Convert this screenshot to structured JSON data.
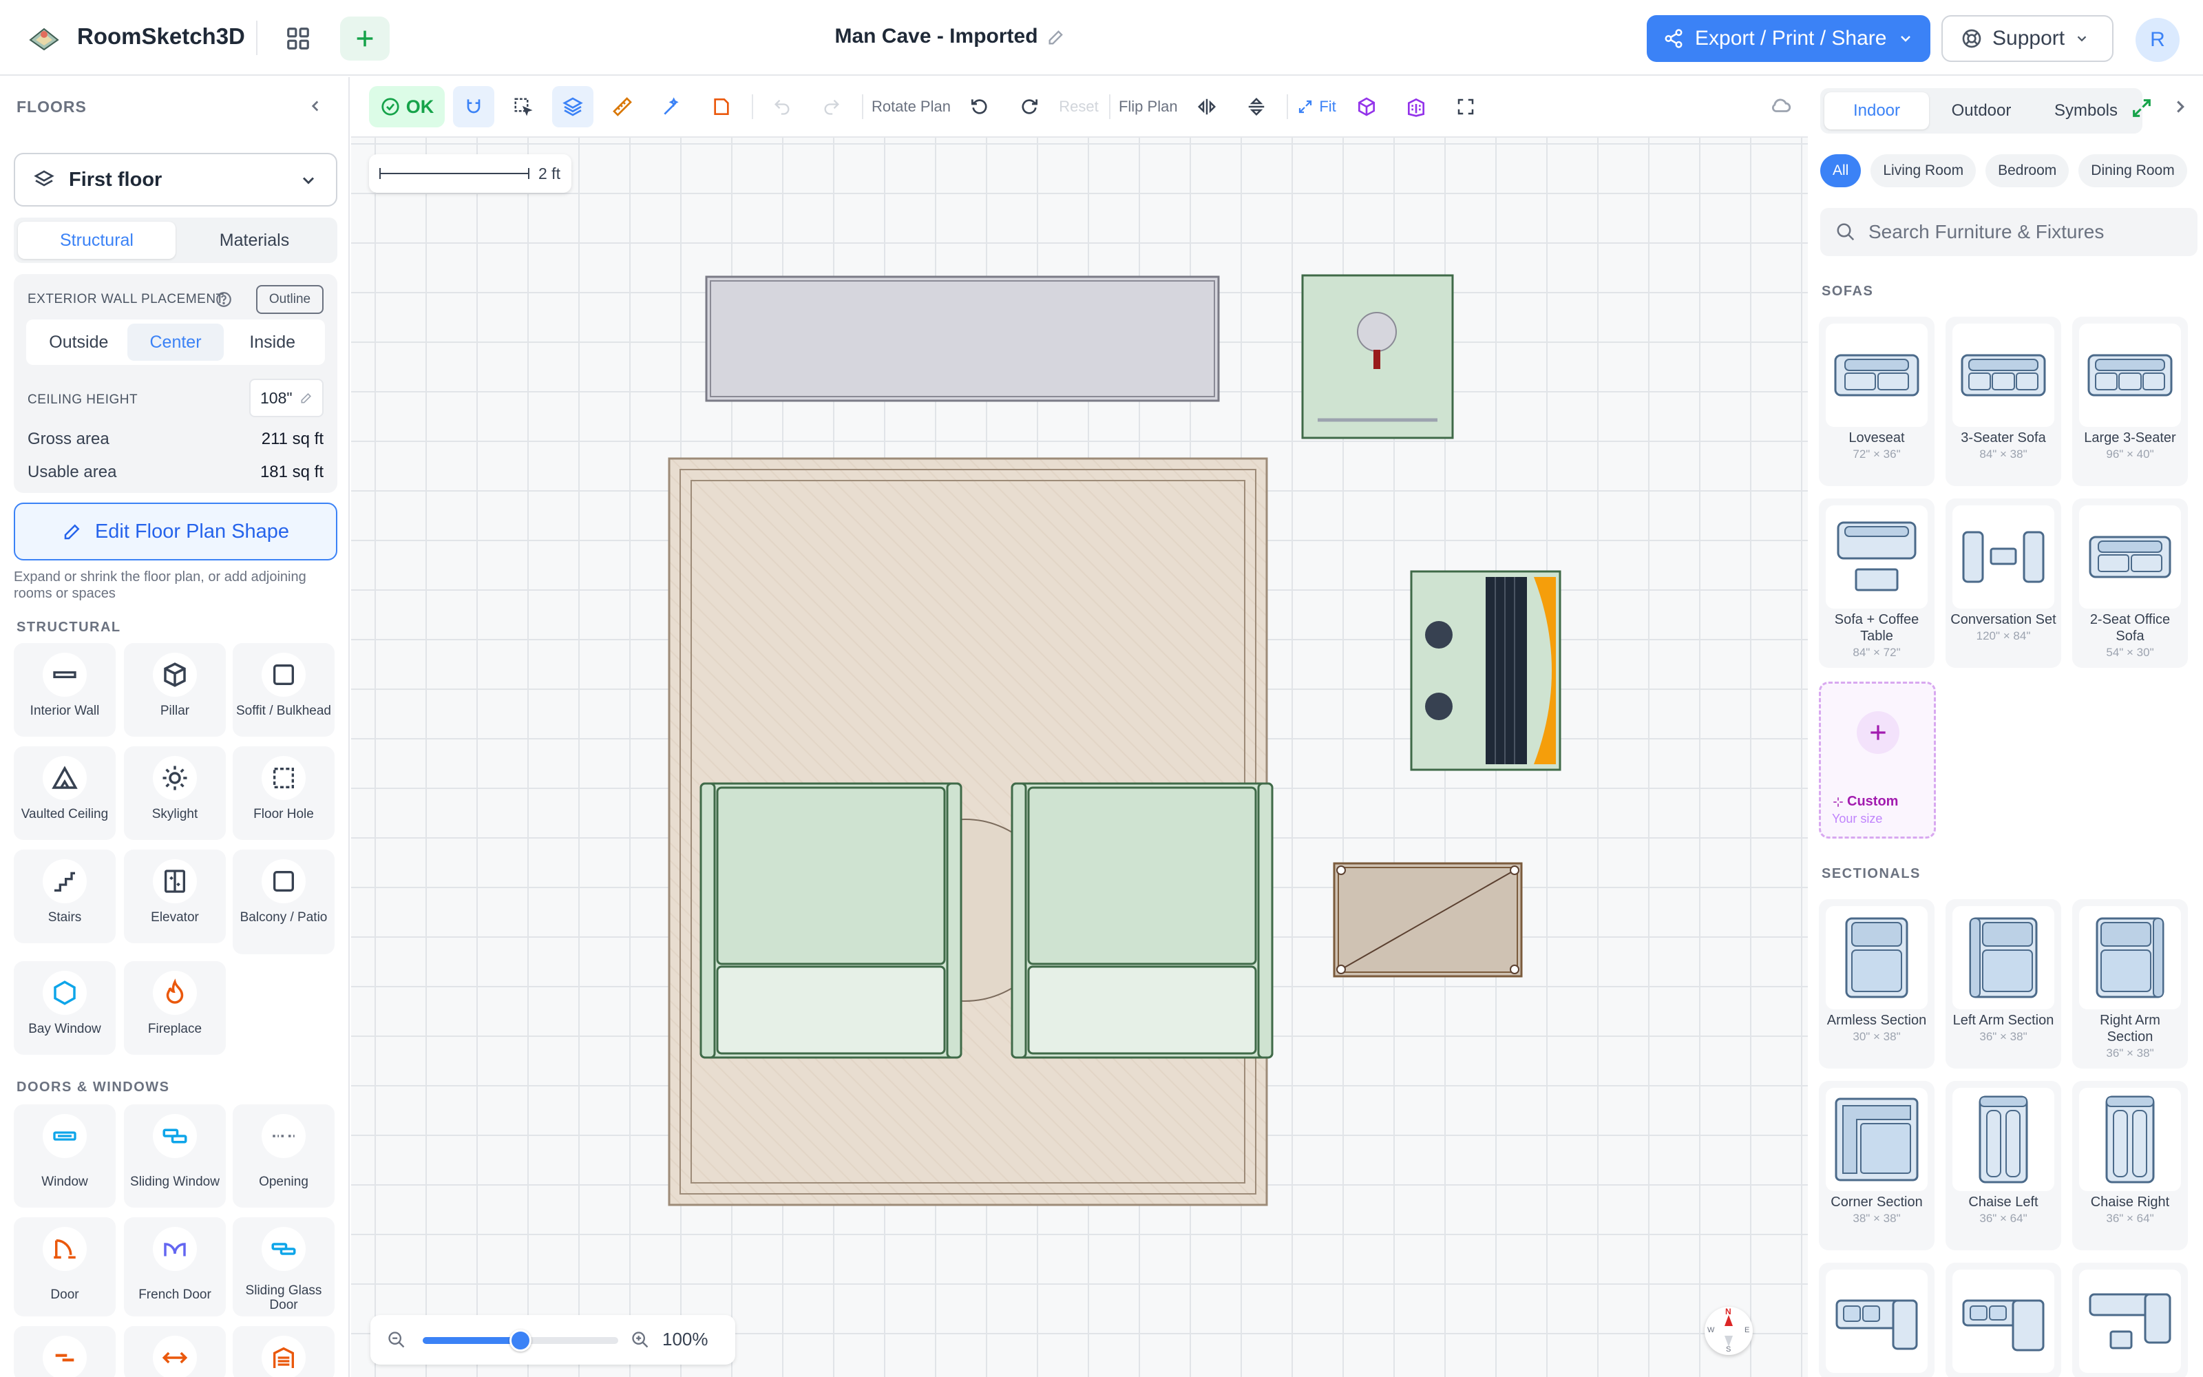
{
  "app": {
    "name": "RoomSketch3D",
    "avatar_initial": "R"
  },
  "header": {
    "project_title": "Man Cave - Imported",
    "export_label": "Export / Print / Share",
    "support_label": "Support"
  },
  "left_panel": {
    "floors_heading": "FLOORS",
    "floor_selected": "First floor",
    "tabs": [
      "Structural",
      "Materials"
    ],
    "active_tab": "Structural",
    "wall_placement": {
      "label": "EXTERIOR WALL PLACEMENT",
      "outline_label": "Outline",
      "options": [
        "Outside",
        "Center",
        "Inside"
      ],
      "active": "Center"
    },
    "ceiling_height": {
      "label": "CEILING HEIGHT",
      "value": "108\""
    },
    "gross_area": {
      "label": "Gross area",
      "value": "211 sq ft"
    },
    "usable_area": {
      "label": "Usable area",
      "value": "181 sq ft"
    },
    "edit_button": "Edit Floor Plan Shape",
    "edit_help": "Expand or shrink the floor plan, or add adjoining rooms or spaces",
    "structural_heading": "STRUCTURAL",
    "structural_items": [
      {
        "label": "Interior Wall",
        "icon": "interior-wall-icon"
      },
      {
        "label": "Pillar",
        "icon": "pillar-icon"
      },
      {
        "label": "Soffit / Bulkhead",
        "icon": "soffit-icon"
      },
      {
        "label": "Vaulted Ceiling",
        "icon": "vaulted-ceiling-icon"
      },
      {
        "label": "Skylight",
        "icon": "skylight-icon"
      },
      {
        "label": "Floor Hole",
        "icon": "floor-hole-icon"
      },
      {
        "label": "Stairs",
        "icon": "stairs-icon"
      },
      {
        "label": "Elevator",
        "icon": "elevator-icon"
      },
      {
        "label": "Balcony / Patio",
        "icon": "balcony-icon"
      },
      {
        "label": "Bay Window",
        "icon": "bay-window-icon"
      },
      {
        "label": "Fireplace",
        "icon": "fireplace-icon"
      }
    ],
    "doors_heading": "DOORS & WINDOWS",
    "door_items": [
      {
        "label": "Window",
        "icon": "window-icon"
      },
      {
        "label": "Sliding Window",
        "icon": "sliding-window-icon"
      },
      {
        "label": "Opening",
        "icon": "opening-icon"
      },
      {
        "label": "Door",
        "icon": "door-icon"
      },
      {
        "label": "French Door",
        "icon": "french-door-icon"
      },
      {
        "label": "Sliding Glass Door",
        "icon": "sliding-glass-door-icon"
      }
    ]
  },
  "canvas_toolbar": {
    "ok_label": "OK",
    "rotate_label": "Rotate Plan",
    "reset_label": "Reset",
    "flip_label": "Flip Plan",
    "fit_label": "Fit"
  },
  "canvas": {
    "scale_label": "2 ft",
    "zoom_level": "100%",
    "zoom_fraction": 0.5,
    "compass": {
      "n": "N",
      "e": "E",
      "s": "S",
      "w": "W"
    }
  },
  "right_panel": {
    "tabs": [
      "Indoor",
      "Outdoor",
      "Symbols"
    ],
    "active_tab": "Indoor",
    "categories": [
      "All",
      "Living Room",
      "Bedroom",
      "Dining Room"
    ],
    "active_category": "All",
    "search_placeholder": "Search Furniture & Fixtures",
    "sofas_heading": "SOFAS",
    "sofas": [
      {
        "name": "Loveseat",
        "dims": "72\" × 36\""
      },
      {
        "name": "3-Seater Sofa",
        "dims": "84\" × 38\""
      },
      {
        "name": "Large 3-Seater",
        "dims": "96\" × 40\""
      },
      {
        "name": "Sofa + Coffee Table",
        "dims": "84\" × 72\""
      },
      {
        "name": "Conversation Set",
        "dims": "120\" × 84\""
      },
      {
        "name": "2-Seat Office Sofa",
        "dims": "54\" × 30\""
      }
    ],
    "custom": {
      "label": "Custom",
      "sub": "Your size"
    },
    "sectionals_heading": "SECTIONALS",
    "sectionals": [
      {
        "name": "Armless Section",
        "dims": "30\" × 38\""
      },
      {
        "name": "Left Arm Section",
        "dims": "36\" × 38\""
      },
      {
        "name": "Right Arm Section",
        "dims": "36\" × 38\""
      },
      {
        "name": "Corner Section",
        "dims": "38\" × 38\""
      },
      {
        "name": "Chaise Left",
        "dims": "36\" × 64\""
      },
      {
        "name": "Chaise Right",
        "dims": "36\" × 64\""
      }
    ]
  },
  "colors": {
    "accent": "#3b82f6",
    "ok_green": "#16a34a",
    "custom_purple": "#a21caf",
    "furniture_green": "#cfe3d1",
    "rug_beige": "#e8ddd0"
  }
}
